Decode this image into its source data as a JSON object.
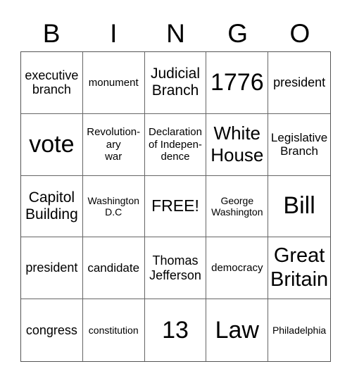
{
  "header": {
    "letters": [
      "B",
      "I",
      "N",
      "G",
      "O"
    ]
  },
  "cells": [
    "executive\nbranch",
    "monument",
    "Judicial\nBranch",
    "1776",
    "president",
    "vote",
    "Revolution-\nary\nwar",
    "Declaration\nof Indepen-\ndence",
    "White\nHouse",
    "Legislative\nBranch",
    "Capitol\nBuilding",
    "Washington\nD.C",
    "FREE!",
    "George\nWashington",
    "Bill",
    "president",
    "candidate",
    "Thomas\nJefferson",
    "democracy",
    "Great\nBritain",
    "congress",
    "constitution",
    "13",
    "Law",
    "Philadelphia"
  ]
}
